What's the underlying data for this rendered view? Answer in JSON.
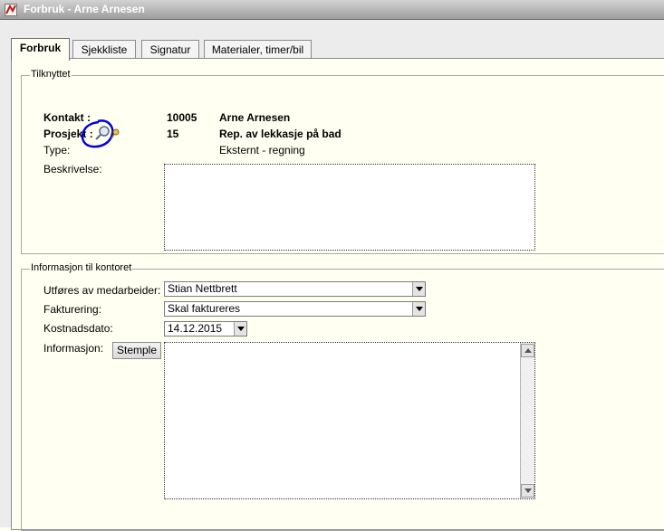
{
  "window": {
    "title": "Forbruk - Arne Arnesen"
  },
  "tabs": [
    {
      "label": "Forbruk",
      "active": true
    },
    {
      "label": "Sjekkliste",
      "active": false
    },
    {
      "label": "Signatur",
      "active": false
    },
    {
      "label": "Materialer, timer/bil",
      "active": false
    }
  ],
  "tilknyttet": {
    "legend": "Tilknyttet",
    "kontakt_label": "Kontakt :",
    "kontakt_nr": "10005",
    "kontakt_navn": "Arne Arnesen",
    "prosjekt_label": "Prosjekt :",
    "prosjekt_nr": "15",
    "prosjekt_navn": "Rep. av lekkasje på bad",
    "type_label": "Type:",
    "type_value": "Eksternt - regning",
    "beskrivelse_label": "Beskrivelse:",
    "beskrivelse_value": ""
  },
  "info": {
    "legend": "Informasjon til kontoret",
    "utfores_label": "Utføres av medarbeider:",
    "utfores_value": "Stian Nettbrett",
    "fakturering_label": "Fakturering:",
    "fakturering_value": "Skal faktureres",
    "kostnadsdato_label": "Kostnadsdato:",
    "kostnadsdato_value": "14.12.2015",
    "informasjon_label": "Informasjon:",
    "stemple_label": "Stemple",
    "informasjon_value": ""
  },
  "icons": {
    "app": "app-icon",
    "search": "magnifier-key-icon"
  },
  "colors": {
    "panel_bg": "#fffff2",
    "annotation": "#0000dd"
  }
}
